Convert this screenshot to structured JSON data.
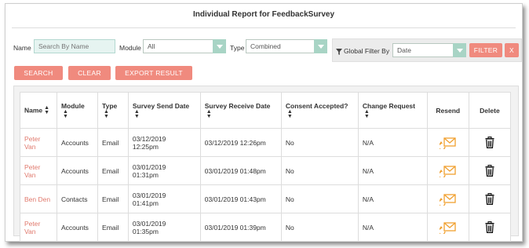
{
  "title": "Individual Report for FeedbackSurvey",
  "filters": {
    "name_label": "Name",
    "name_placeholder": "Search By Name",
    "module_label": "Module",
    "module_value": "All",
    "type_label": "Type",
    "type_value": "Combined",
    "global_filter_label": "Global Filter By",
    "global_filter_value": "Date",
    "filter_button": "FILTER",
    "clear_x_button": "X"
  },
  "actions": {
    "search": "SEARCH",
    "clear": "CLEAR",
    "export": "EXPORT RESULT"
  },
  "table": {
    "headers": [
      "Name",
      "Module",
      "Type",
      "Survey Send Date",
      "Survey Receive Date",
      "Consent Accepted?",
      "Change Request",
      "Resend",
      "Delete"
    ],
    "rows": [
      {
        "name_line1": "Peter",
        "name_line2": "Van",
        "module": "Accounts",
        "type": "Email",
        "send_line1": "03/12/2019",
        "send_line2": "12:25pm",
        "receive": "03/12/2019 12:26pm",
        "consent": "No",
        "change": "N/A"
      },
      {
        "name_line1": "Peter",
        "name_line2": "Van",
        "module": "Accounts",
        "type": "Email",
        "send_line1": "03/01/2019",
        "send_line2": "01:31pm",
        "receive": "03/01/2019 01:48pm",
        "consent": "No",
        "change": "N/A"
      },
      {
        "name_line1": "Ben Den",
        "name_line2": "",
        "module": "Contacts",
        "type": "Email",
        "send_line1": "03/01/2019",
        "send_line2": "01:41pm",
        "receive": "03/01/2019 01:43pm",
        "consent": "No",
        "change": "N/A"
      },
      {
        "name_line1": "Peter",
        "name_line2": "Van",
        "module": "Accounts",
        "type": "Email",
        "send_line1": "03/01/2019",
        "send_line2": "01:35pm",
        "receive": "03/01/2019 01:39pm",
        "consent": "No",
        "change": "N/A"
      }
    ]
  },
  "icons": {
    "resend": "envelope-resend-icon",
    "delete": "trash-icon",
    "filter": "funnel-icon",
    "sort": "sort-icon"
  },
  "colors": {
    "accent": "#f08a7e",
    "name_link": "#e0796d",
    "resend_icon": "#f0a030",
    "select_arrow": "#a8d4c5"
  }
}
